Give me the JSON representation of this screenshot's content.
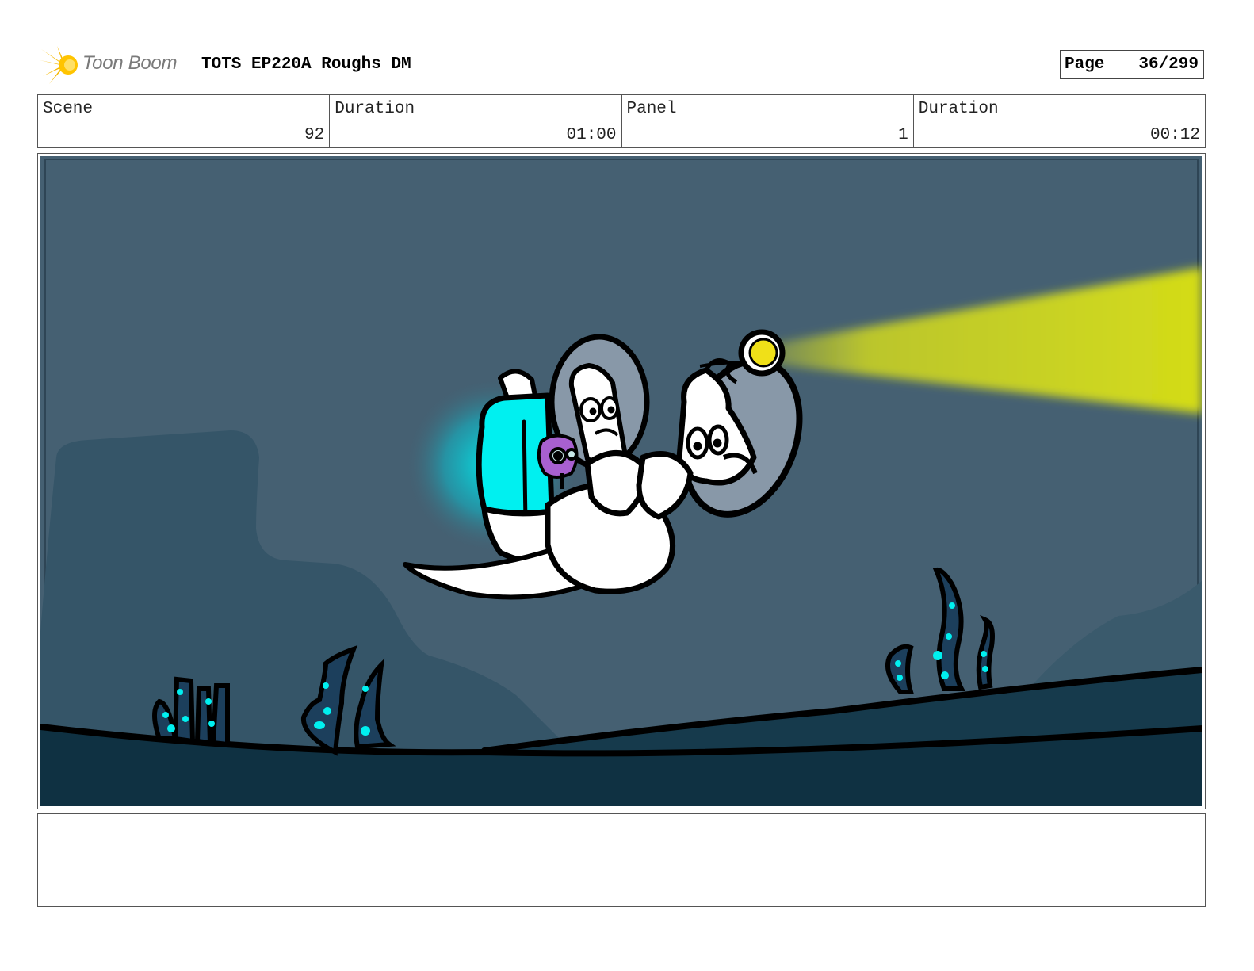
{
  "header": {
    "brand": "Toon Boom",
    "title": "TOTS EP220A Roughs DM",
    "page_label": "Page",
    "page_number": "36/299"
  },
  "info": {
    "scene_label": "Scene",
    "scene_value": "92",
    "scene_duration_label": "Duration",
    "scene_duration_value": "01:00",
    "panel_label": "Panel",
    "panel_value": "1",
    "panel_duration_label": "Duration",
    "panel_duration_value": "00:12"
  },
  "colors": {
    "water": "#456072",
    "mountain": "#355568",
    "seafloor": "#0f3142",
    "glow_cyan": "#00f0f0",
    "headlight": "#f0e018",
    "beam": "#d0d820",
    "creature": "#a860d0"
  },
  "notes": {
    "text": ""
  }
}
